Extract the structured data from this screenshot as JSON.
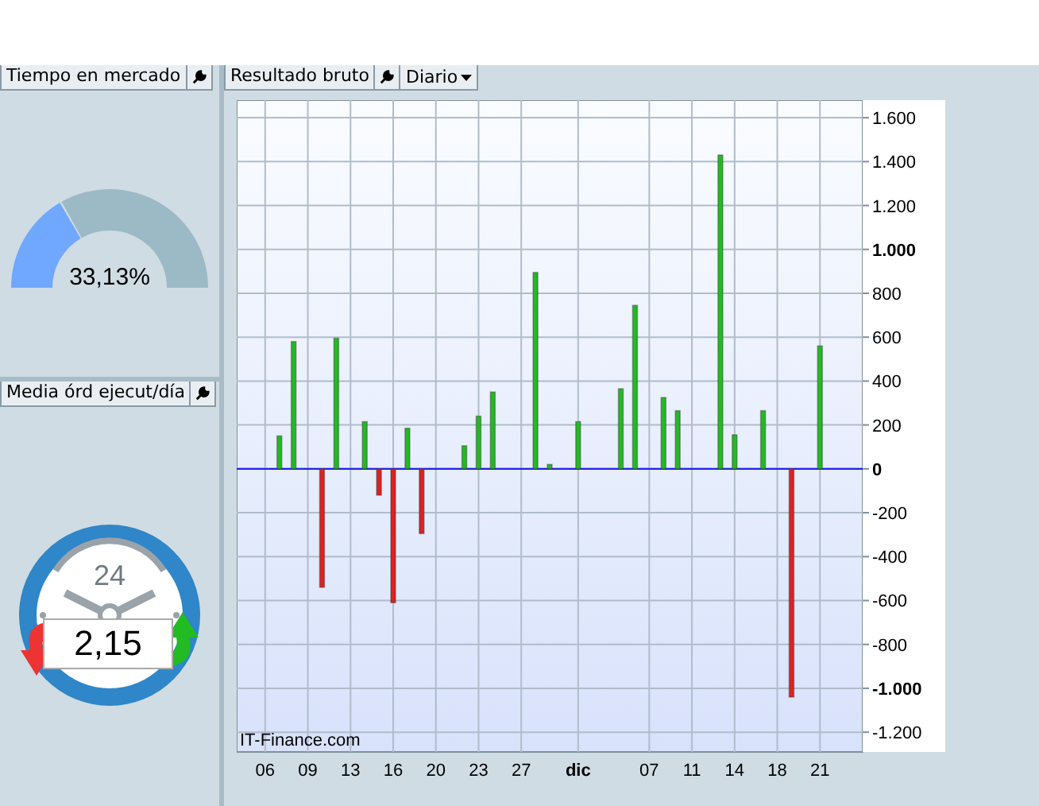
{
  "panels": [
    {
      "kind": "gauge",
      "title": "Tiempo en mercado",
      "level": 0.3313,
      "reading": "33,13%"
    },
    {
      "kind": "clock",
      "title": "Media órd ejecut/día",
      "clock_label": "24",
      "reading": "2,15"
    }
  ],
  "chart_panel": {
    "title": "Resultado bruto",
    "period": "Diario",
    "watermark": "IT-Finance.com",
    "chart_data": {
      "type": "bar",
      "categories": [
        "06",
        null,
        null,
        "09",
        null,
        null,
        "13",
        null,
        null,
        "16",
        null,
        null,
        "20",
        null,
        null,
        "23",
        null,
        null,
        "27",
        null,
        null,
        null,
        "dic",
        null,
        null,
        null,
        null,
        "07",
        null,
        null,
        "11",
        null,
        null,
        "14",
        null,
        null,
        "18",
        null,
        null,
        "21"
      ],
      "series": [
        {
          "color": "#22bb22",
          "values": [
            null,
            150,
            580,
            null,
            null,
            595,
            null,
            215,
            null,
            null,
            185,
            null,
            null,
            null,
            105,
            240,
            350,
            null,
            null,
            895,
            20,
            null,
            215,
            null,
            null,
            365,
            745,
            null,
            325,
            265,
            null,
            null,
            1430,
            155,
            null,
            265,
            null,
            null,
            null,
            560
          ]
        },
        {
          "color": "#dd2222",
          "values": [
            null,
            null,
            null,
            null,
            -540,
            null,
            null,
            null,
            -120,
            -610,
            null,
            -295,
            null,
            null,
            null,
            null,
            null,
            null,
            null,
            null,
            null,
            null,
            null,
            null,
            null,
            null,
            null,
            null,
            null,
            null,
            null,
            null,
            null,
            null,
            null,
            null,
            null,
            -1040,
            null,
            null
          ]
        }
      ],
      "stacked": true,
      "grid": true,
      "ref_lines": [
        {
          "axis": "y",
          "value": 0,
          "color": "#2222ee"
        }
      ],
      "ylim": [
        -1290,
        1680
      ],
      "yticks": [
        {
          "value": 1600,
          "label": "1.600"
        },
        {
          "value": 1400,
          "label": "1.400"
        },
        {
          "value": 1200,
          "label": "1.200"
        },
        {
          "value": 1000,
          "label": "1.000"
        },
        {
          "value": 800,
          "label": "800"
        },
        {
          "value": 600,
          "label": "600"
        },
        {
          "value": 400,
          "label": "400"
        },
        {
          "value": 200,
          "label": "200"
        },
        {
          "value": 0,
          "label": "0"
        },
        {
          "value": -200,
          "label": "-200"
        },
        {
          "value": -400,
          "label": "-400"
        },
        {
          "value": -600,
          "label": "-600"
        },
        {
          "value": -800,
          "label": "-800"
        },
        {
          "value": -1000,
          "label": "-1.000"
        },
        {
          "value": -1200,
          "label": "-1.200"
        }
      ]
    }
  }
}
